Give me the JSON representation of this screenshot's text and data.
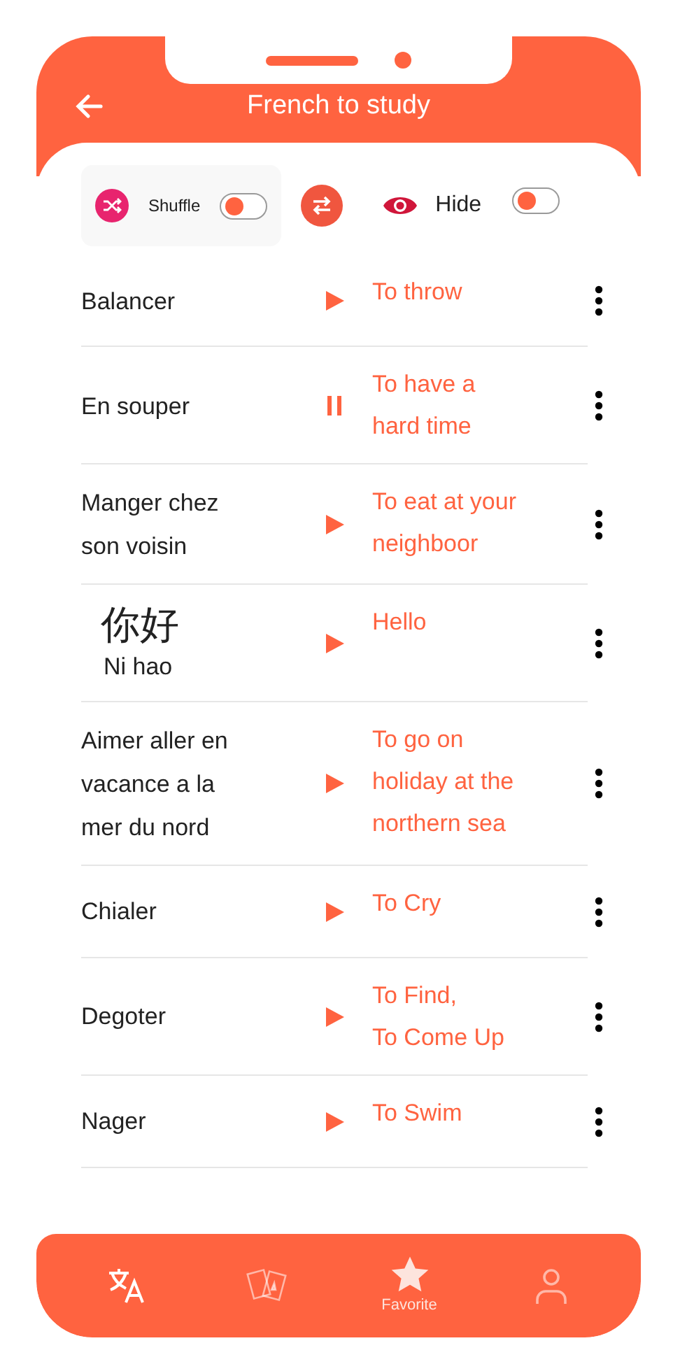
{
  "header": {
    "title": "French to study"
  },
  "controls": {
    "shuffle": {
      "label": "Shuffle",
      "on": false
    },
    "hide": {
      "label": "Hide",
      "on": false
    }
  },
  "words": [
    {
      "word": "Balancer",
      "translation": "To throw",
      "playing": false
    },
    {
      "word": "En souper",
      "translation": "To have a\nhard time",
      "playing": true
    },
    {
      "word": "Manger chez\nson voisin",
      "translation": "To eat at your\nneighboor",
      "playing": false
    },
    {
      "word": "你好",
      "reading": "Ni hao",
      "translation": "Hello",
      "playing": false
    },
    {
      "word": "Aimer aller en\nvacance a la\nmer du nord",
      "translation": "To go on\nholiday at the\nnorthern sea",
      "playing": false
    },
    {
      "word": "Chialer",
      "translation": "To Cry",
      "playing": false
    },
    {
      "word": "Degoter",
      "translation": "To Find,\nTo Come Up",
      "playing": false
    },
    {
      "word": "Nager",
      "translation": "To Swim",
      "playing": false
    }
  ],
  "nav": [
    {
      "kind": "translate",
      "selected": false
    },
    {
      "kind": "cards",
      "selected": false
    },
    {
      "kind": "star",
      "label": "Favorite",
      "selected": true
    },
    {
      "kind": "profile",
      "selected": false
    }
  ]
}
